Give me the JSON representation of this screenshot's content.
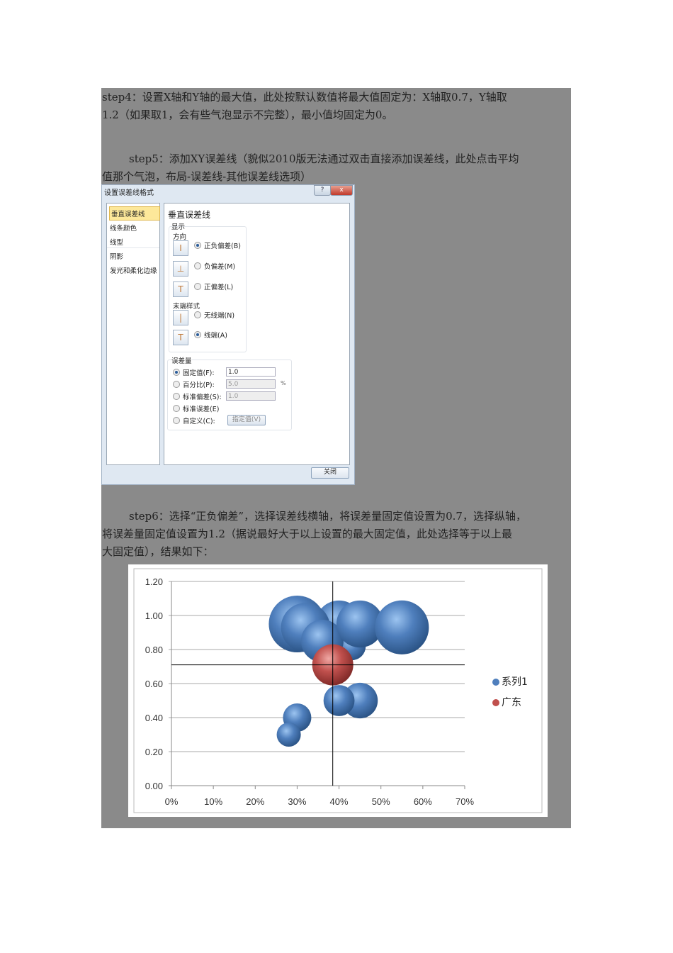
{
  "text": {
    "step4_line1": "step4：设置X轴和Y轴的最大值，此处按默认数值将最大值固定为：X轴取0.7，Y轴取",
    "step4_line2": "1.2（如果取1，会有些气泡显示不完整），最小值均固定为0。",
    "step5_line1": "step5：添加XY误差线（貌似2010版无法通过双击直接添加误差线，此处点击平均",
    "step5_line2": "值那个气泡，布局-误差线-其他误差线选项）",
    "step6_line1": "step6：选择“正负偏差”，选择误差线横轴，将误差量固定值设置为0.7，选择纵轴，",
    "step6_line2": "将误差量固定值设置为1.2（据说最好大于以上设置的最大固定值，此处选择等于以上最",
    "step6_line3": "大固定值），结果如下："
  },
  "dialog": {
    "title": "设置误差线格式",
    "help": "?",
    "close_x": "x",
    "nav": [
      "垂直误差线",
      "线条颜色",
      "线型",
      "阴影",
      "发光和柔化边缘"
    ],
    "heading": "垂直误差线",
    "display_label": "显示",
    "direction_label": "方向",
    "directions": [
      "正负偏差(B)",
      "负偏差(M)",
      "正偏差(L)"
    ],
    "endstyle_label": "末端样式",
    "endstyles": [
      "无线端(N)",
      "线端(A)"
    ],
    "amount_label": "误差量",
    "amounts": [
      "固定值(F):",
      "百分比(P):",
      "标准偏差(S):",
      "标准误差(E)",
      "自定义(C):"
    ],
    "fixed_value": "1.0",
    "percent_value": "5.0",
    "percent_unit": "%",
    "stddev_value": "1.0",
    "specify_button": "指定值(V)",
    "close_button": "关闭"
  },
  "chart_data": {
    "type": "scatter",
    "subtype": "bubble",
    "xlim": [
      0,
      0.7
    ],
    "ylim": [
      0,
      1.2
    ],
    "xticks": [
      "0%",
      "10%",
      "20%",
      "30%",
      "40%",
      "50%",
      "60%",
      "70%"
    ],
    "yticks": [
      "0.00",
      "0.20",
      "0.40",
      "0.60",
      "0.80",
      "1.00",
      "1.20"
    ],
    "grid": true,
    "legend_position": "right",
    "series": [
      {
        "name": "系列1",
        "color": "#4f7fbd",
        "points": [
          {
            "x": 0.3,
            "y": 0.95,
            "size": 16
          },
          {
            "x": 0.4,
            "y": 0.95,
            "size": 11
          },
          {
            "x": 0.43,
            "y": 0.82,
            "size": 4
          },
          {
            "x": 0.32,
            "y": 0.93,
            "size": 12
          },
          {
            "x": 0.36,
            "y": 0.85,
            "size": 9
          },
          {
            "x": 0.45,
            "y": 0.95,
            "size": 11
          },
          {
            "x": 0.55,
            "y": 0.93,
            "size": 14.5
          },
          {
            "x": 0.45,
            "y": 0.5,
            "size": 6.3
          },
          {
            "x": 0.4,
            "y": 0.5,
            "size": 4.8
          },
          {
            "x": 0.3,
            "y": 0.4,
            "size": 4
          },
          {
            "x": 0.28,
            "y": 0.3,
            "size": 2.9
          }
        ]
      },
      {
        "name": "广东",
        "color": "#c0504d",
        "points": [
          {
            "x": 0.385,
            "y": 0.71,
            "size": 8.4
          }
        ]
      }
    ],
    "error_bars": {
      "x_fixed": 0.7,
      "y_fixed": 1.2,
      "direction": "both"
    }
  }
}
